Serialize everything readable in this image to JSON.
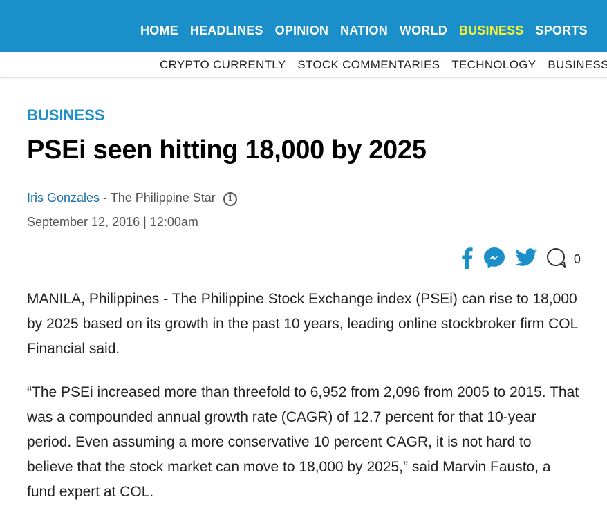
{
  "topnav": {
    "items": [
      "HOME",
      "HEADLINES",
      "OPINION",
      "NATION",
      "WORLD",
      "BUSINESS",
      "SPORTS"
    ],
    "active": "BUSINESS",
    "bg_color": "#1a8fc9",
    "active_color": "#f5f03a"
  },
  "subnav": {
    "items": [
      "CRYPTO CURRENTLY",
      "STOCK COMMENTARIES",
      "TECHNOLOGY",
      "BUSINESS"
    ]
  },
  "article": {
    "section": "BUSINESS",
    "headline": "PSEi seen hitting 18,000 by 2025",
    "author": "Iris Gonzales",
    "publication": " - The Philippine Star",
    "date": "September 12, 2016 | 12:00am",
    "paragraphs": [
      "MANILA, Philippines - The Philippine Stock Exchange index (PSEi) can rise to 18,000  by 2025 based on its growth in the past 10 years, leading online stockbroker firm COL Financial said.",
      "“The PSEi increased more than threefold to 6,952 from 2,096 from 2005 to 2015. That was a compounded annual growth rate (CAGR) of 12.7 percent for that 10-year period. Even assuming a more conservative 10 percent CAGR, it is not hard to believe that the stock market can move to 18,000 by 2025,” said Marvin  Fausto, a fund expert at COL."
    ]
  },
  "share": {
    "icons": [
      "facebook-icon",
      "messenger-icon",
      "twitter-icon",
      "comment-icon"
    ],
    "comment_count": "0",
    "icon_color": "#1a8fc9"
  }
}
